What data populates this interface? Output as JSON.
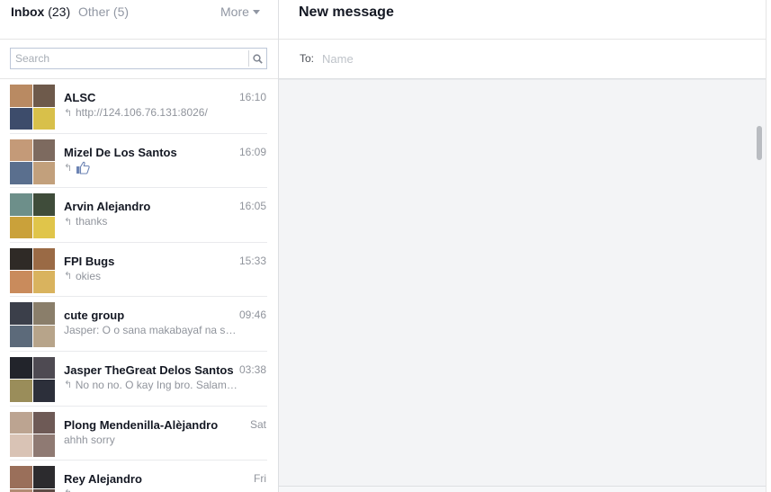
{
  "tabs": {
    "inbox_label": "Inbox",
    "inbox_count": "(23)",
    "other_label": "Other (5)",
    "more_label": "More"
  },
  "search": {
    "placeholder": "Search"
  },
  "compose": {
    "title": "New message",
    "to_label": "To:",
    "to_placeholder": "Name"
  },
  "threads": [
    {
      "name": "ALSC",
      "time": "16:10",
      "snippet": "http://124.106.76.131:8026/",
      "replied": true,
      "avatar_colors": [
        "#b98a62",
        "#6e5a4b",
        "#3d4c6b",
        "#d8c04a"
      ]
    },
    {
      "name": "Mizel De Los Santos",
      "time": "16:09",
      "snippet": "",
      "replied": true,
      "like_icon": "thumbs-up-icon",
      "avatar_colors": [
        "#c49a78",
        "#7d6a5f",
        "#5a6f8e",
        "#c2a07c"
      ]
    },
    {
      "name": "Arvin Alejandro",
      "time": "16:05",
      "snippet": "thanks",
      "replied": true,
      "avatar_colors": [
        "#6d8f8a",
        "#3f4c3a",
        "#caa13a",
        "#e0c54a"
      ]
    },
    {
      "name": "FPI Bugs",
      "time": "15:33",
      "snippet": "okies",
      "replied": true,
      "avatar_colors": [
        "#2f2a26",
        "#9a6a45",
        "#c98b5c",
        "#d9b35e"
      ]
    },
    {
      "name": "cute group",
      "time": "09:46",
      "snippet": "Jasper: O o sana makabayaf na sil...",
      "replied": false,
      "avatar_colors": [
        "#3b3f4a",
        "#8a7e6a",
        "#5c6a7a",
        "#b7a48a"
      ]
    },
    {
      "name": "Jasper TheGreat Delos Santos",
      "time": "03:38",
      "snippet": "No no no. O kay Ing bro. Salama...",
      "replied": true,
      "avatar_colors": [
        "#22242b",
        "#4e4a52",
        "#9a8d5a",
        "#2c2f3a"
      ]
    },
    {
      "name": "Plong Mendenilla-Alèjandro",
      "time": "Sat",
      "snippet": "ahhh sorry",
      "replied": false,
      "avatar_colors": [
        "#bca491",
        "#6e5a56",
        "#d9c3b5",
        "#8f7a73"
      ]
    },
    {
      "name": "Rey Alejandro",
      "time": "Fri",
      "snippet": "",
      "replied": true,
      "avatar_colors": [
        "#9a6f5a",
        "#2c2b2e",
        "#b28b73",
        "#5d4b45"
      ]
    }
  ],
  "colors": {
    "accent_blue": "#4267b2",
    "divider": "#e5e5e5",
    "muted_text": "#90949c",
    "pane_bg": "#f3f4f6"
  }
}
